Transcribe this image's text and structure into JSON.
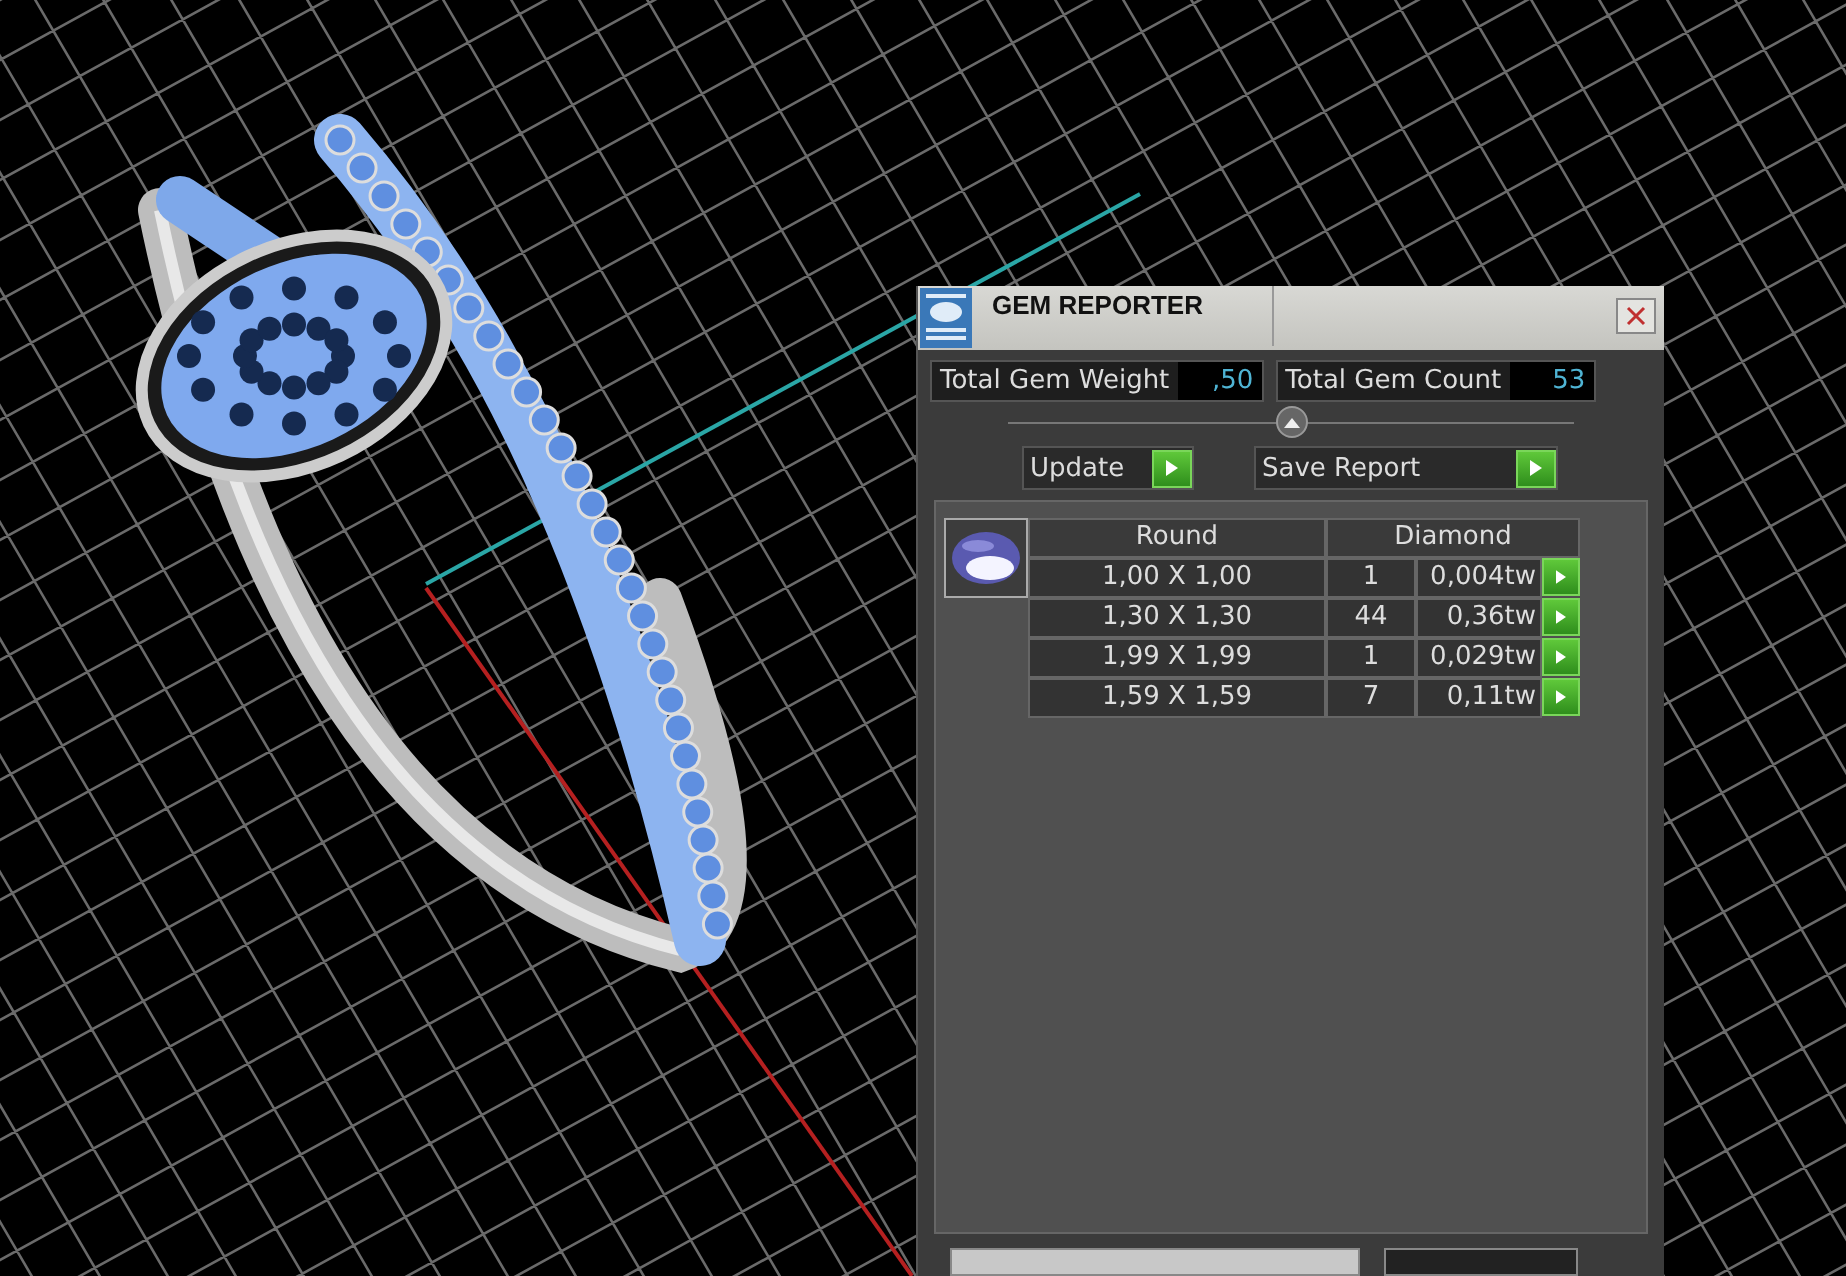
{
  "window": {
    "title": "GEM REPORTER"
  },
  "totals": [
    {
      "label": "Total Gem Weight",
      "value": ",50"
    },
    {
      "label": "Total Gem Count",
      "value": "53"
    }
  ],
  "buttons": [
    "Update",
    "Save Report"
  ],
  "table": {
    "columns": [
      "Round",
      "Diamond"
    ],
    "rows": [
      {
        "size": "1,00 X 1,00",
        "count": "1",
        "weight": "0,004tw"
      },
      {
        "size": "1,30 X 1,30",
        "count": "44",
        "weight": "0,36tw"
      },
      {
        "size": "1,99 X 1,99",
        "count": "1",
        "weight": "0,029tw"
      },
      {
        "size": "1,59 X 1,59",
        "count": "7",
        "weight": "0,11tw"
      }
    ]
  }
}
